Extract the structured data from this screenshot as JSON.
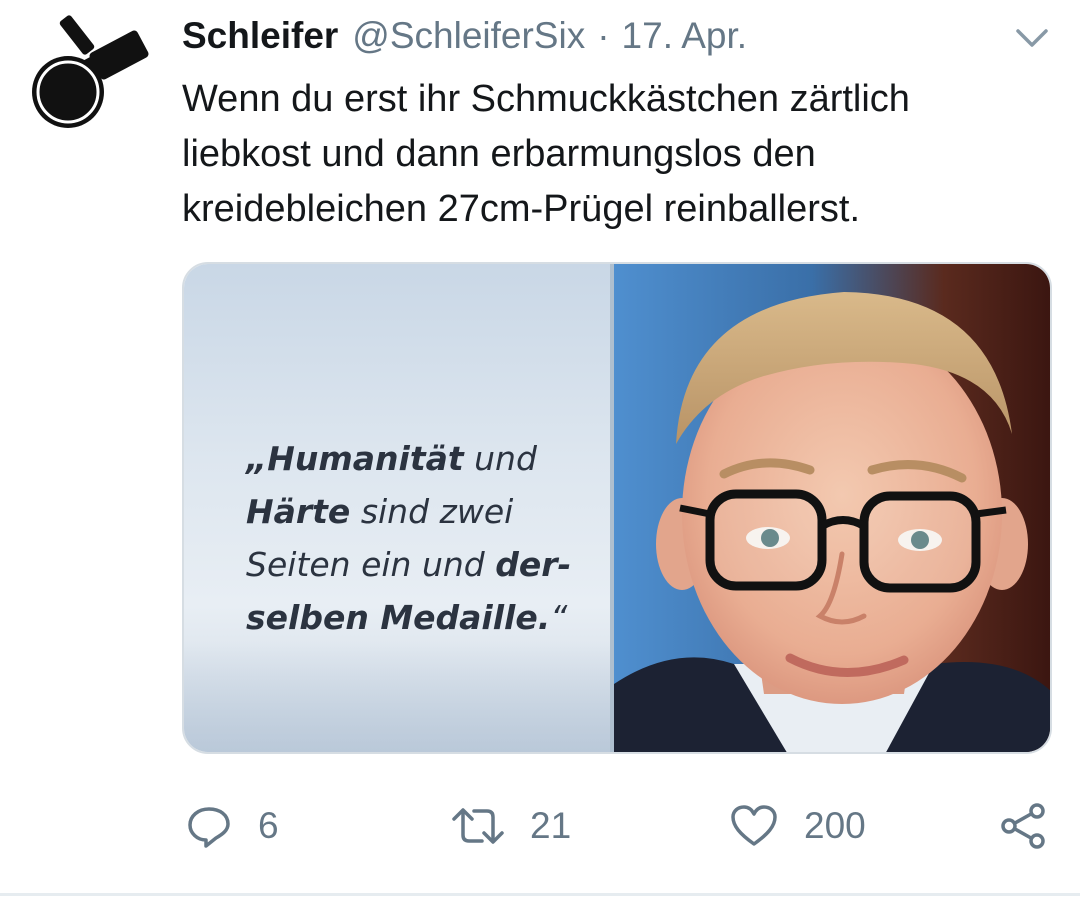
{
  "user": {
    "display_name": "Schleifer",
    "handle": "@SchleiferSix",
    "separator": "·",
    "date": "17. Apr."
  },
  "tweet": {
    "text": "Wenn du erst ihr Schmuckkästchen zärtlich liebkost und dann erbarmungslos den kreidebleichen 27cm-Prügel reinballerst."
  },
  "media": {
    "quote": {
      "l1a": "„Humanität",
      "l1b": " und",
      "l2a": "Härte",
      "l2b": " sind zwei",
      "l3a": "Seiten ein und ",
      "l3b": "der-",
      "l4a": "selben Medaille.",
      "l4b": "“"
    }
  },
  "actions": {
    "reply_count": "6",
    "retweet_count": "21",
    "like_count": "200"
  },
  "icons": {
    "avatar": "angle-grinder-avatar",
    "menu": "chevron-down-icon",
    "reply": "reply-icon",
    "retweet": "retweet-icon",
    "like": "heart-icon",
    "share": "share-icon"
  },
  "colors": {
    "text": "#14171a",
    "secondary": "#657786",
    "border": "#e6ecf0"
  }
}
